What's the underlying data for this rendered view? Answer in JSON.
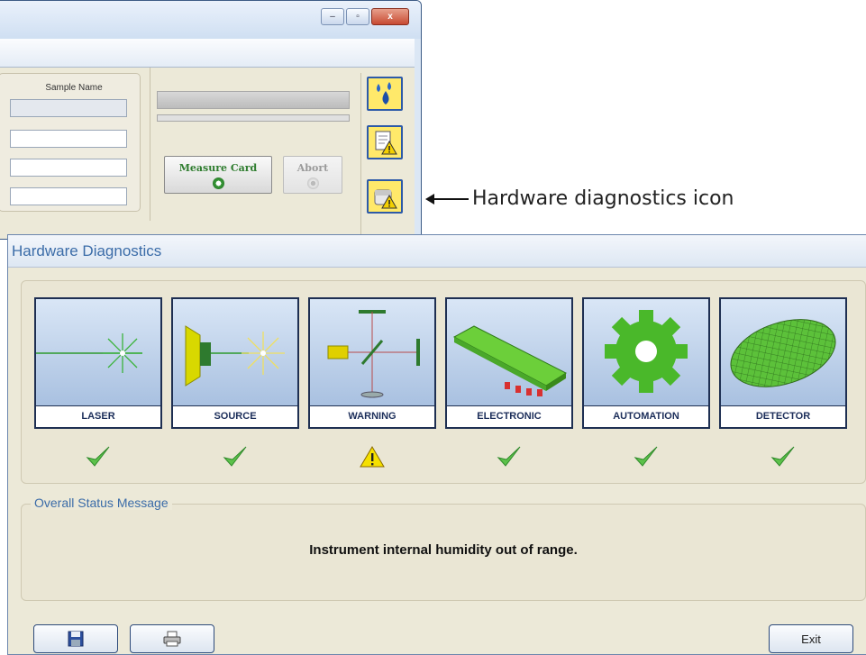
{
  "top_window": {
    "buttons": {
      "minimize": "–",
      "maximize": "▫",
      "close": "x"
    },
    "sample_name_label": "Sample Name",
    "measure_button": "Measure Card",
    "abort_button": "Abort",
    "side_icons": [
      "drops-icon",
      "report-warning-icon",
      "hardware-diagnostics-icon"
    ]
  },
  "annotation": "Hardware diagnostics icon",
  "diagnostics": {
    "title": "Hardware Diagnostics",
    "tiles": [
      {
        "label": "LASER",
        "status": "ok"
      },
      {
        "label": "SOURCE",
        "status": "ok"
      },
      {
        "label": "WARNING",
        "status": "warning"
      },
      {
        "label": "ELECTRONIC",
        "status": "ok"
      },
      {
        "label": "AUTOMATION",
        "status": "ok"
      },
      {
        "label": "DETECTOR",
        "status": "ok"
      }
    ],
    "overall_status_title": "Overall Status Message",
    "overall_status_message": "Instrument internal humidity out of range.",
    "exit_label": "Exit"
  },
  "colors": {
    "ok_green": "#5cc14a",
    "warning_yellow": "#f5e000",
    "title_blue": "#3b6ca8"
  }
}
